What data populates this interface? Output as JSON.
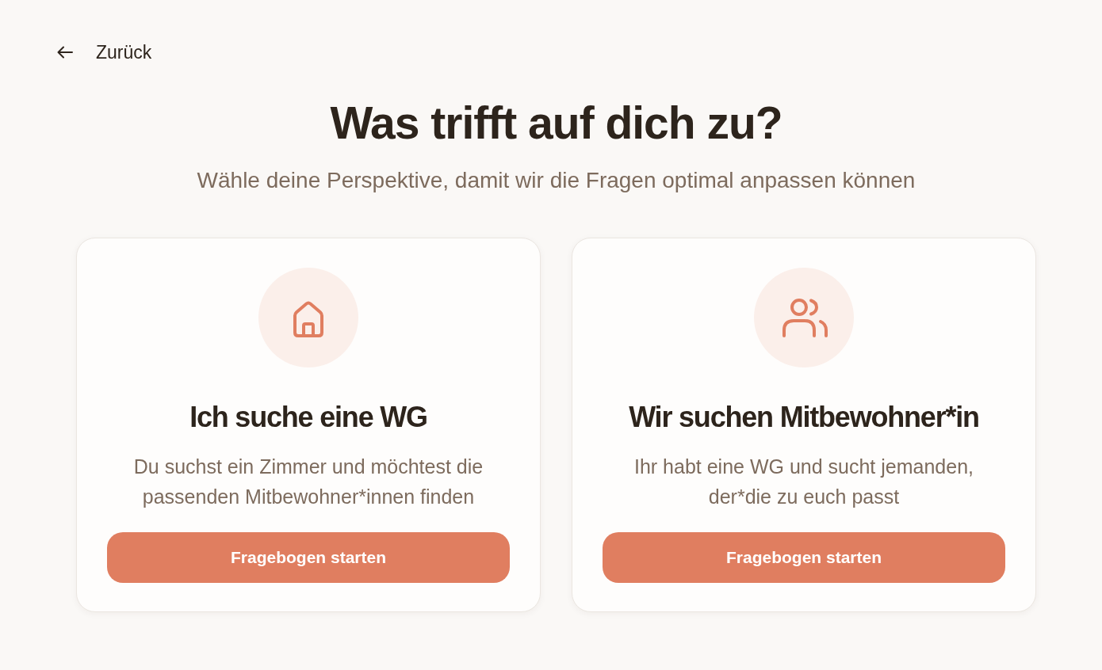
{
  "back_link": {
    "label": "Zurück"
  },
  "heading": {
    "title": "Was trifft auf dich zu?",
    "subtitle": "Wähle deine Perspektive, damit wir die Fragen optimal anpassen können"
  },
  "cards": [
    {
      "kind": "seeker",
      "title": "Ich suche eine WG",
      "description": "Du suchst ein Zimmer und möchtest die passenden Mitbewohner*innen finden",
      "button": "Fragebogen starten"
    },
    {
      "kind": "household",
      "title": "Wir suchen Mitbewohner*in",
      "description": "Ihr habt eine WG und sucht jemanden, der*die zu euch passt",
      "button": "Fragebogen starten"
    }
  ]
}
